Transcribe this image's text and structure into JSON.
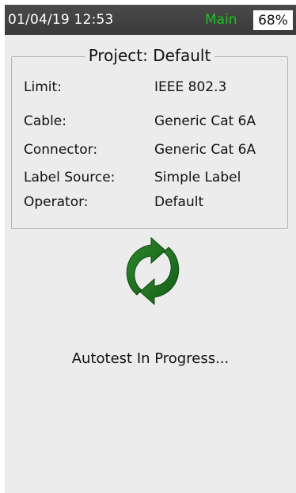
{
  "status_bar": {
    "datetime": "01/04/19 12:53",
    "mode": "Main",
    "battery": "68%"
  },
  "project": {
    "title": "Project: Default",
    "rows": [
      {
        "label": "Limit:",
        "value": "IEEE 802.3"
      },
      {
        "label": "Cable:",
        "value": "Generic Cat 6A"
      },
      {
        "label": "Connector:",
        "value": "Generic Cat 6A"
      },
      {
        "label": "Label Source:",
        "value": "Simple Label"
      },
      {
        "label": "Operator:",
        "value": "Default"
      }
    ]
  },
  "progress": {
    "icon": "refresh-icon",
    "message": "Autotest In Progress..."
  },
  "colors": {
    "status_bar_bg": "#3f3f3f",
    "mode_text": "#20c020",
    "icon_green": "#1e6b1e",
    "panel_bg": "#ececec"
  }
}
